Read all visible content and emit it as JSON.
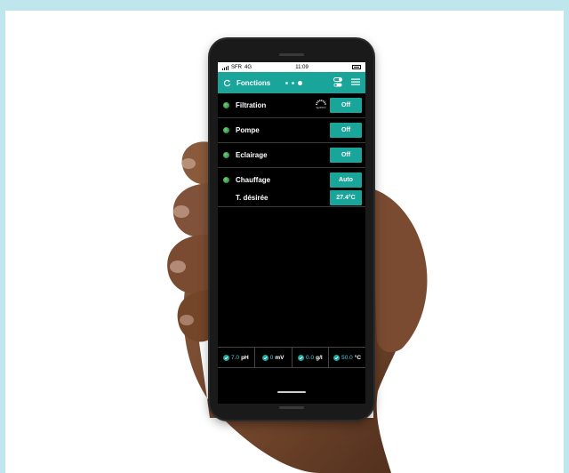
{
  "status_bar": {
    "carrier": "SFR",
    "network": "4G",
    "time": "11:09"
  },
  "app_bar": {
    "title": "Fonctions",
    "accent_color": "#1aa59a"
  },
  "rows": [
    {
      "label": "Filtration",
      "button": "Off",
      "extra_icon": "speed-gauge-icon",
      "extra_label": "speed"
    },
    {
      "label": "Pompe",
      "button": "Off"
    },
    {
      "label": "Eclairage",
      "button": "Off"
    },
    {
      "label": "Chauffage",
      "button": "Auto",
      "sub_label": "T. désirée",
      "sub_button": "27.4°C"
    }
  ],
  "metrics": [
    {
      "value": "7.0",
      "unit": "pH"
    },
    {
      "value": "0",
      "unit": "mV"
    },
    {
      "value": "0.0",
      "unit": "g/l"
    },
    {
      "value": "50.0",
      "unit": "°C"
    }
  ]
}
